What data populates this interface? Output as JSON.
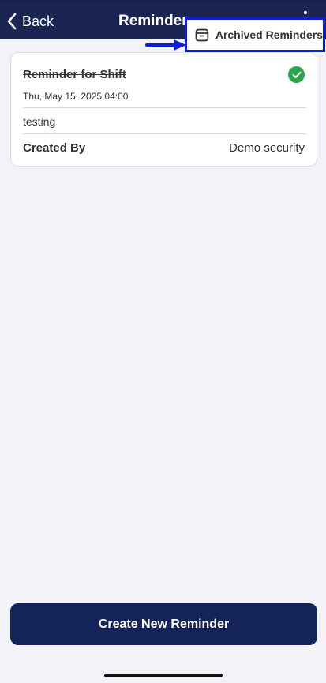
{
  "navbar": {
    "back_label": "Back",
    "title": "Reminder"
  },
  "menu": {
    "archived_label": "Archived Reminders",
    "highlight_color": "#0a1fd6"
  },
  "reminder": {
    "title": "Reminder for Shift",
    "completed": true,
    "datetime": "Thu, May 15, 2025 04:00",
    "description": "testing",
    "created_by_label": "Created By",
    "created_by_value": "Demo security"
  },
  "actions": {
    "create_label": "Create New Reminder"
  },
  "colors": {
    "navbar": "#1a2552",
    "button": "#14245a",
    "success": "#2ea44f",
    "background": "#f2f2f7"
  }
}
